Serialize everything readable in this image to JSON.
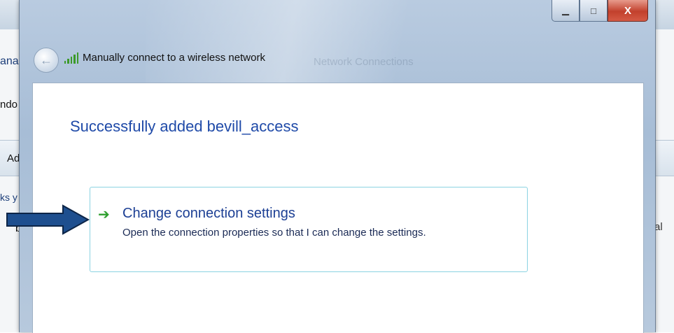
{
  "background": {
    "left_fragments": [
      "ana",
      "ndo",
      "Ad",
      "ks y",
      "b"
    ],
    "right_fragment": "tical"
  },
  "dialog": {
    "title": "Manually connect to a wireless network",
    "faint_title": "Network Connections",
    "caption": {
      "minimize": "▁",
      "maximize": "□",
      "close": "X"
    },
    "heading": "Successfully added bevill_access",
    "option": {
      "title": "Change connection settings",
      "description": "Open the connection properties so that I can change the settings."
    }
  },
  "icons": {
    "back": "back-arrow-icon",
    "signal": "wireless-signal-icon",
    "option_arrow": "green-arrow-icon",
    "annotation": "blue-pointer-arrow"
  },
  "colors": {
    "heading": "#1f4aa8",
    "link_title": "#1c3f94",
    "option_arrow": "#2e9f2e",
    "annotation_arrow": "#1e4f8f",
    "link_border": "#8bd3e2"
  }
}
